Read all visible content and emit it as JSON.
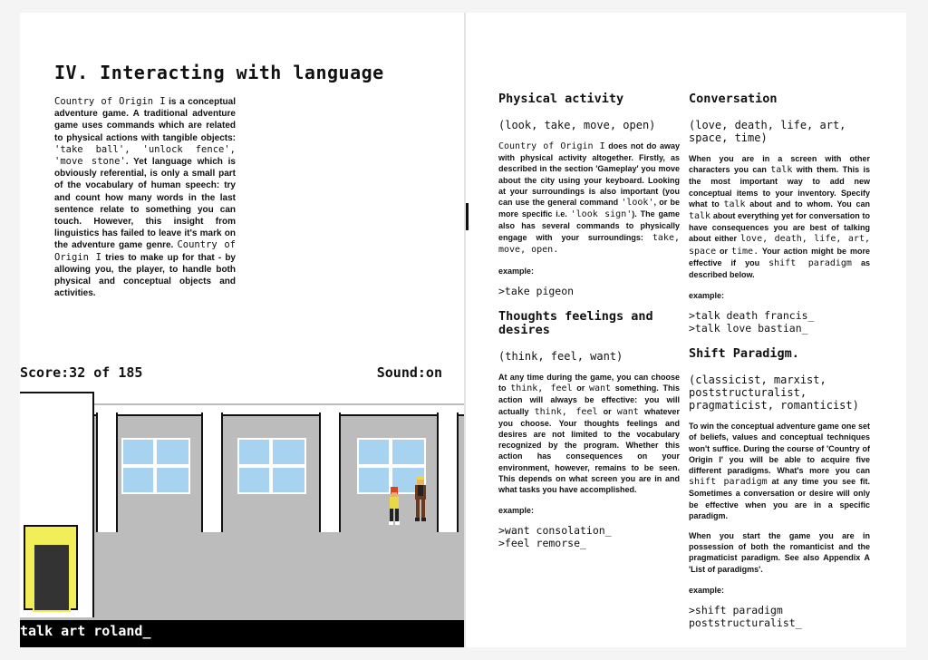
{
  "left": {
    "heading": "IV. Interacting with language",
    "intro": [
      {
        "t": "Country of Origin I",
        "code": true
      },
      {
        "t": " is a conceptual adventure game. A traditional adventure game uses commands which are related to physical actions with tangible objects: ",
        "code": false
      },
      {
        "t": "'take ball', 'unlock fence', 'move stone'",
        "code": true
      },
      {
        "t": ". Yet language which is obviously referential, is only a small part of the vocabulary of human speech: try and count how many words in the last sentence relate to something you can touch. However, this insight from linguistics has failed to leave it's mark on the adventure game genre. ",
        "code": false
      },
      {
        "t": "Country of Origin I",
        "code": true
      },
      {
        "t": " tries to make up for that - by allowing you, the player, to handle both physical and conceptual objects and activities.",
        "code": false
      }
    ]
  },
  "game": {
    "score": "Score:32 of 185",
    "sound": "Sound:on",
    "command": "talk art roland_",
    "colors": {
      "wall": "#bcbcbc",
      "window": "#a7d3f0",
      "door": "#f2ee5a"
    }
  },
  "right": {
    "physical": {
      "title": "Physical activity",
      "args": "(look, take, move, open)",
      "body": [
        {
          "t": "Country of Origin I",
          "code": true
        },
        {
          "t": " does not do away with physical activity altogether. Firstly, as described in the section 'Gameplay' you move about the city using your keyboard. Looking at your surroundings is also important (you can use the general command ",
          "code": false
        },
        {
          "t": "'look'",
          "code": true
        },
        {
          "t": ", or be more specific i.e. ",
          "code": false
        },
        {
          "t": "'look sign'",
          "code": true
        },
        {
          "t": "). The game also has several commands to physically engage with your surroundings: ",
          "code": false
        },
        {
          "t": "take, move, open.",
          "code": true
        }
      ],
      "example_label": "example:",
      "examples": [
        ">take pigeon"
      ]
    },
    "thoughts": {
      "title": "Thoughts feelings and desires",
      "args": "(think, feel, want)",
      "body": [
        {
          "t": "At any time during the game, you can choose to ",
          "code": false
        },
        {
          "t": "think, feel",
          "code": true
        },
        {
          "t": " or ",
          "code": false
        },
        {
          "t": "want",
          "code": true
        },
        {
          "t": " something. This action will always be effective: you will actually ",
          "code": false
        },
        {
          "t": "think, feel",
          "code": true
        },
        {
          "t": " or ",
          "code": false
        },
        {
          "t": "want",
          "code": true
        },
        {
          "t": " whatever you choose. Your thoughts feelings and desires are not limited to the vocabulary recognized by the program. Whether this action has consequences on your environment, however, remains to be seen. This depends on what screen you are in and what tasks you have accomplished.",
          "code": false
        }
      ],
      "example_label": "example:",
      "examples": [
        ">want consolation_",
        ">feel remorse_"
      ]
    },
    "conversation": {
      "title": "Conversation",
      "args": "(love, death, life, art, space, time)",
      "body": [
        {
          "t": "When you are in a screen with other characters you can ",
          "code": false
        },
        {
          "t": "talk",
          "code": true
        },
        {
          "t": " with them. This is the most important way to add new conceptual items to your inventory. Specify what to ",
          "code": false
        },
        {
          "t": "talk",
          "code": true
        },
        {
          "t": " about and to whom. You can ",
          "code": false
        },
        {
          "t": "talk",
          "code": true
        },
        {
          "t": " about everything yet for conversation to have consequences you are best of talking about either ",
          "code": false
        },
        {
          "t": "love, death, life, art, space",
          "code": true
        },
        {
          "t": " or ",
          "code": false
        },
        {
          "t": "time.",
          "code": true
        },
        {
          "t": " Your action might be more effective if you ",
          "code": false
        },
        {
          "t": "shift paradigm",
          "code": true
        },
        {
          "t": " as described below.",
          "code": false
        }
      ],
      "example_label": "example:",
      "examples": [
        ">talk death francis_",
        ">talk love bastian_"
      ]
    },
    "shift": {
      "title": "Shift Paradigm.",
      "args": "(classicist, marxist, poststructuralist, pragmaticist, romanticist)",
      "body": [
        {
          "t": "To win the conceptual adventure game one set of beliefs, values and conceptual techniques won't suffice. During the course of 'Country of Origin I' you will be able to acquire five different paradigms. What's more you can ",
          "code": false
        },
        {
          "t": "shift paradigm",
          "code": true
        },
        {
          "t": " at any time you see fit. Sometimes a conversation or desire will only be effective when you are in a specific paradigm.",
          "code": false
        }
      ],
      "body2": "When you start the game you are in possession of both the romanticist and the pragmaticist paradigm. See also Appendix A 'List of paradigms'.",
      "example_label": "example:",
      "examples": [
        ">shift paradigm poststructuralist_"
      ]
    }
  }
}
